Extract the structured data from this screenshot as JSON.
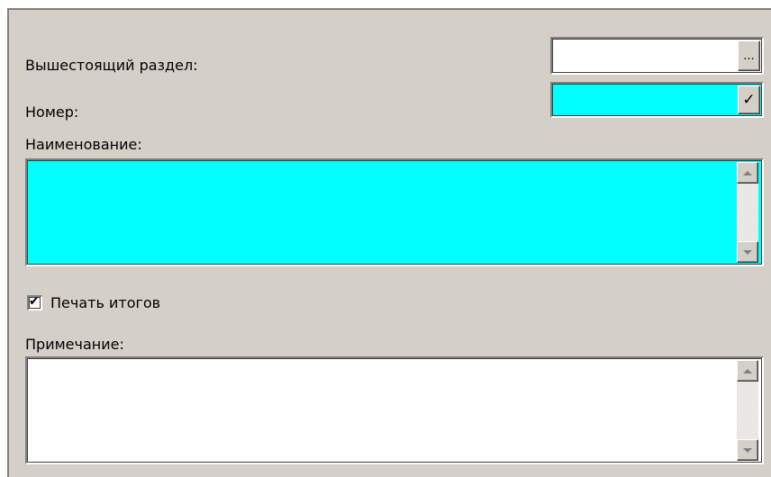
{
  "form": {
    "parent_section": {
      "label": "Вышестоящий раздел:",
      "value": "",
      "button_glyph": "..."
    },
    "number": {
      "label": "Номер:",
      "value": "",
      "button_glyph": "✓"
    },
    "name": {
      "label": "Наименование:",
      "value": ""
    },
    "print_totals": {
      "label": "Печать итогов",
      "checked": true,
      "check_glyph": "✔"
    },
    "note": {
      "label": "Примечание:",
      "value": ""
    }
  },
  "colors": {
    "highlight_field": "#00ffff",
    "window_bg": "#d4d0c8",
    "white_field": "#ffffff"
  },
  "icons": {
    "ellipsis": "ellipsis-icon",
    "check": "check-icon",
    "scroll_up": "scroll-up-arrow-icon",
    "scroll_down": "scroll-down-arrow-icon",
    "checkbox_check": "checkmark-icon"
  }
}
